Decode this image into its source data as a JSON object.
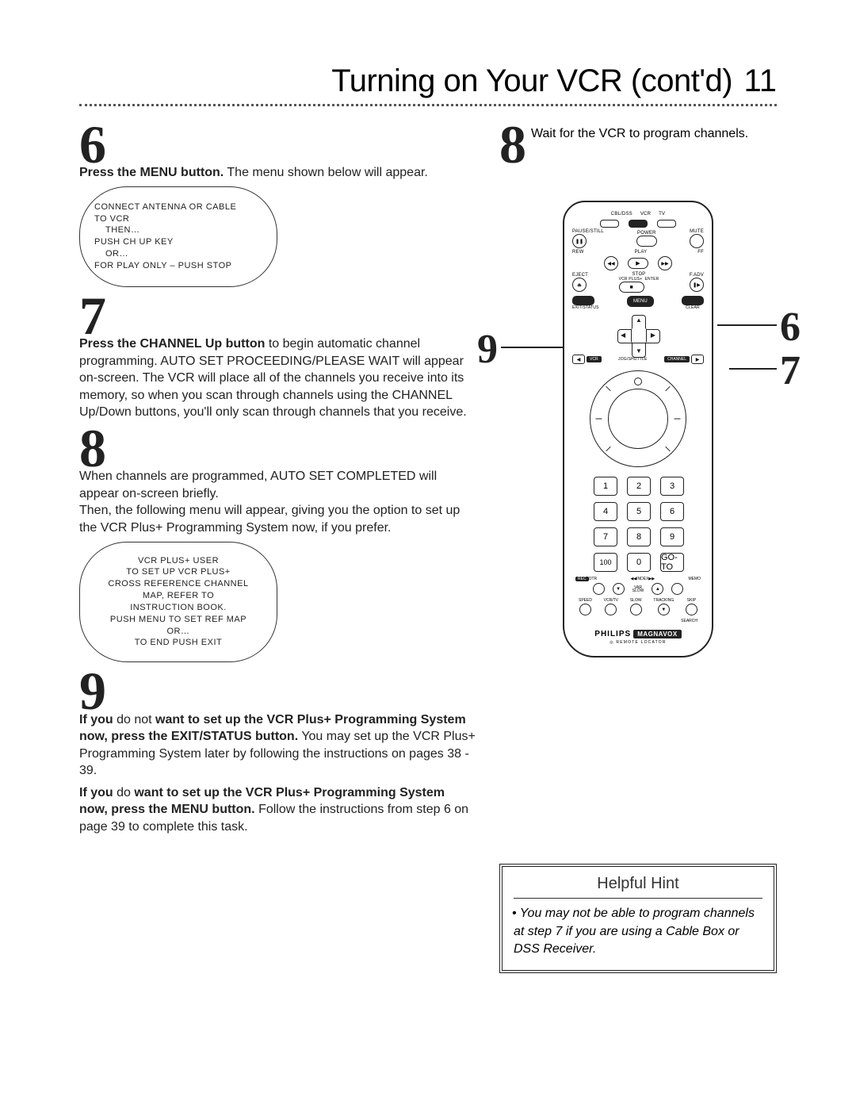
{
  "header": {
    "title": "Turning on Your VCR (cont'd)",
    "page_number": "11"
  },
  "left": {
    "step6": {
      "num": "6",
      "body_bold": "Press the MENU button.",
      "body_rest": " The menu shown below will appear.",
      "crt": {
        "l1": "CONNECT ANTENNA OR CABLE",
        "l2": "TO  VCR",
        "l3": "THEN…",
        "l4": "PUSH CH UP KEY",
        "l5": "OR…",
        "l6": "FOR PLAY ONLY – PUSH STOP"
      }
    },
    "step7": {
      "num": "7",
      "body_bold": "Press the CHANNEL Up button",
      "body_rest": " to begin automatic channel programming. AUTO SET PROCEEDING/PLEASE WAIT will appear on-screen. The VCR will place all of the channels you receive into its memory, so when you scan through channels using the CHANNEL Up/Down buttons, you'll only scan through channels that you receive."
    },
    "step8": {
      "num": "8",
      "body1": "When channels are programmed, AUTO SET COMPLETED will appear on-screen briefly.",
      "body2": "Then, the following menu will appear, giving you the option to set up the VCR Plus+ Programming System now, if you prefer.",
      "crt": {
        "l1": "VCR PLUS+ USER",
        "l2": "TO SET UP  VCR PLUS+",
        "l3": "CROSS REFERENCE CHANNEL",
        "l4": "MAP, REFER TO",
        "l5": "INSTRUCTION BOOK.",
        "l6": "PUSH MENU TO SET REF MAP",
        "l7": "OR…",
        "l8": "TO END PUSH EXIT"
      }
    },
    "step9": {
      "num": "9",
      "p1a_bold": "If you",
      "p1a_rest": " do not ",
      "p1b_bold": "want to set up the VCR Plus+ Programming System now, press the EXIT/STATUS button.",
      "p1b_rest": " You may set up the VCR Plus+ Programming System later by following the instructions on pages 38 - 39.",
      "p2a_bold": "If you",
      "p2a_rest": " do ",
      "p2b_bold": "want to set up the VCR Plus+ Programming System now, press the MENU button.",
      "p2b_rest": " Follow the instructions from step 6 on page 39 to complete this task."
    }
  },
  "right": {
    "step8": {
      "num": "8",
      "text": "Wait for the VCR to program channels."
    },
    "callouts": {
      "c6": "6",
      "c7": "7",
      "c9": "9"
    },
    "hint": {
      "title": "Helpful Hint",
      "body": "You may not be able to program channels at step 7 if you are using a Cable Box or DSS Receiver."
    }
  },
  "remote": {
    "top_modes": {
      "a": "CBL/DSS",
      "b": "VCR",
      "c": "TV"
    },
    "row2": {
      "pause": "PAUSE/STILL",
      "power": "POWER",
      "mute": "MUTE"
    },
    "transport": {
      "rew": "REW",
      "play": "PLAY",
      "ff": "FF"
    },
    "row4": {
      "eject": "EJECT",
      "stop": "STOP",
      "fadv": "F.ADV",
      "vcrplus": "VCR PLUS+",
      "enter": "ENTER"
    },
    "row5": {
      "exit": "EXIT/STATUS",
      "menu": "MENU",
      "clear": "CLEAR"
    },
    "dpad": {
      "jog": "JOG/SHUTTLE",
      "vcr": "VCR",
      "channel": "CHANNEL"
    },
    "numpad": [
      "1",
      "2",
      "3",
      "4",
      "5",
      "6",
      "7",
      "8",
      "9",
      "100",
      "0",
      "GO-TO"
    ],
    "mid": {
      "rec": "REC",
      "otr": "OTR",
      "index": "INDEX",
      "memo": "MEMO",
      "var": "VAR",
      "slow": "SLOW"
    },
    "bottom_labels": [
      "SPEED",
      "VCR/TV",
      "SLOW",
      "TRACKING",
      "SKIP"
    ],
    "search": "SEARCH",
    "brand": {
      "a": "PHILIPS",
      "b": "MAGNAVOX"
    },
    "footer": "REMOTE LOCATOR"
  }
}
